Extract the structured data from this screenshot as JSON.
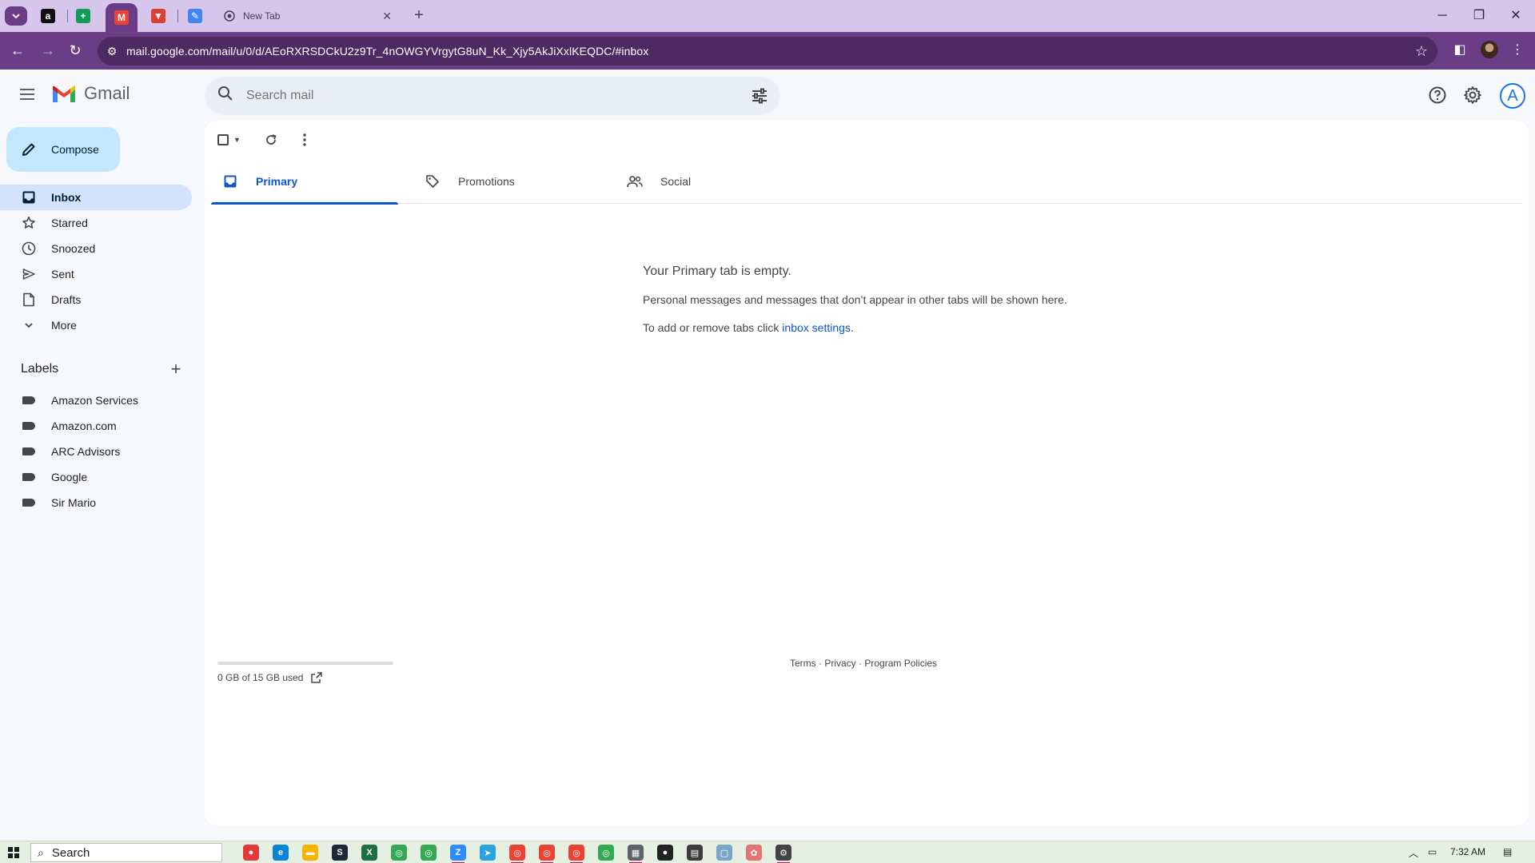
{
  "browser": {
    "tabs": [
      {
        "name": "Amazon",
        "color": "#111111",
        "glyph": "a"
      },
      {
        "name": "Google Sheets",
        "color": "#0f9d58",
        "glyph": "+"
      },
      {
        "name": "Gmail",
        "color": "#ea4335",
        "glyph": "M",
        "active": true
      },
      {
        "name": "Todoist",
        "color": "#db4035",
        "glyph": "▼"
      },
      {
        "name": "Pen tool",
        "color": "#4285f4",
        "glyph": "✎"
      }
    ],
    "new_tab_title": "New Tab",
    "url": "mail.google.com/mail/u/0/d/AEoRXRSDCkU2z9Tr_4nOWGYVrgytG8uN_Kk_Xjy5AkJiXxlKEQDC/#inbox"
  },
  "header": {
    "app_name": "Gmail",
    "search_placeholder": "Search mail",
    "avatar_letter": "A"
  },
  "sidebar": {
    "compose_label": "Compose",
    "items": [
      {
        "label": "Inbox",
        "icon": "inbox-icon",
        "active": true
      },
      {
        "label": "Starred",
        "icon": "star-icon"
      },
      {
        "label": "Snoozed",
        "icon": "clock-icon"
      },
      {
        "label": "Sent",
        "icon": "send-icon"
      },
      {
        "label": "Drafts",
        "icon": "draft-icon"
      },
      {
        "label": "More",
        "icon": "chevron-down-icon"
      }
    ],
    "labels_title": "Labels",
    "labels": [
      "Amazon Services",
      "Amazon.com",
      "ARC Advisors",
      "Google",
      "Sir Mario"
    ]
  },
  "main": {
    "tabs": [
      {
        "label": "Primary",
        "icon": "inbox-icon",
        "active": true
      },
      {
        "label": "Promotions",
        "icon": "tag-icon"
      },
      {
        "label": "Social",
        "icon": "people-icon"
      }
    ],
    "empty_title": "Your Primary tab is empty.",
    "empty_line1": "Personal messages and messages that don’t appear in other tabs will be shown here.",
    "empty_line2_prefix": "To add or remove tabs click ",
    "empty_line2_link": "inbox settings",
    "empty_line2_suffix": ".",
    "storage_text": "0 GB of 15 GB used",
    "storage_fraction": 0.0,
    "footer": {
      "terms": "Terms",
      "privacy": "Privacy",
      "policies": "Program Policies",
      "sep": " · "
    }
  },
  "taskbar": {
    "search_label": "Search",
    "apps": [
      {
        "name": "record",
        "color": "#e53935",
        "glyph": "●"
      },
      {
        "name": "edge",
        "color": "#0a84d6",
        "glyph": "e"
      },
      {
        "name": "explorer",
        "color": "#f4b400",
        "glyph": "▬"
      },
      {
        "name": "steam",
        "color": "#1b2838",
        "glyph": "S"
      },
      {
        "name": "excel",
        "color": "#1d6f42",
        "glyph": "X"
      },
      {
        "name": "chrome-1",
        "color": "#34a853",
        "glyph": "◎"
      },
      {
        "name": "chrome-2",
        "color": "#34a853",
        "glyph": "◎"
      },
      {
        "name": "zoom",
        "color": "#2d8cff",
        "glyph": "Z",
        "open": true
      },
      {
        "name": "telegram",
        "color": "#2aa3df",
        "glyph": "➤"
      },
      {
        "name": "chrome-3",
        "color": "#ea4335",
        "glyph": "◎",
        "open": true
      },
      {
        "name": "chrome-4",
        "color": "#ea4335",
        "glyph": "◎",
        "open": true
      },
      {
        "name": "chrome-5",
        "color": "#ea4335",
        "glyph": "◎",
        "open": true
      },
      {
        "name": "chrome-6",
        "color": "#34a853",
        "glyph": "◎"
      },
      {
        "name": "calculator",
        "color": "#5f6368",
        "glyph": "▦",
        "open": true
      },
      {
        "name": "obs",
        "color": "#222222",
        "glyph": "●"
      },
      {
        "name": "sticky",
        "color": "#3c3c3c",
        "glyph": "▤"
      },
      {
        "name": "notepad",
        "color": "#7aa7c7",
        "glyph": "▢"
      },
      {
        "name": "paint",
        "color": "#e57373",
        "glyph": "✿"
      },
      {
        "name": "settings",
        "color": "#444444",
        "glyph": "⚙",
        "open": true
      }
    ],
    "time": "7:32 AM"
  }
}
